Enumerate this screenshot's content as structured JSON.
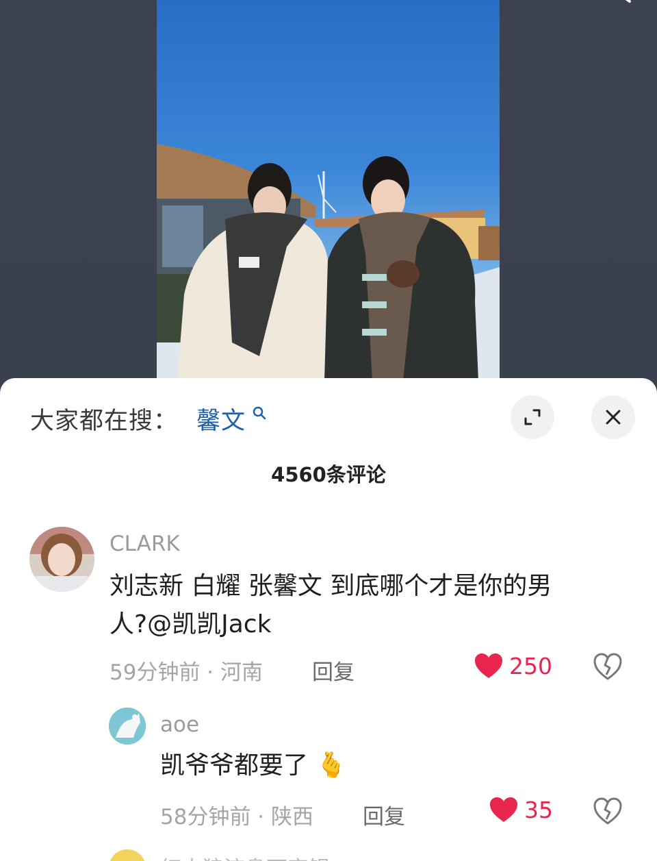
{
  "search_bar": {
    "prompt": "大家都在搜：",
    "keyword": "馨文"
  },
  "comments_header": {
    "count_label": "4560条评论"
  },
  "comments": [
    {
      "username": "CLARK",
      "text_line1": "刘志新 白耀 张馨文 到底哪个才是你的男",
      "text_line2": "人?@凯凯Jack",
      "meta": "59分钟前 · 河南",
      "reply_label": "回复",
      "likes": "250"
    },
    {
      "username": "aoe",
      "text": "凯爷爷都要了",
      "emoji": "🫰",
      "meta": "58分钟前 · 陕西",
      "reply_label": "回复",
      "likes": "35"
    },
    {
      "username": "红太狼流鼻下字银"
    }
  ],
  "colors": {
    "like_red": "#e8244f",
    "keyword_blue": "#1d5fa8",
    "video_background": "#3b4150"
  },
  "icons": {
    "expand": "expand-icon",
    "close": "close-icon",
    "like": "heart-icon",
    "dislike": "broken-heart-icon",
    "keyword_search": "search-icon"
  }
}
